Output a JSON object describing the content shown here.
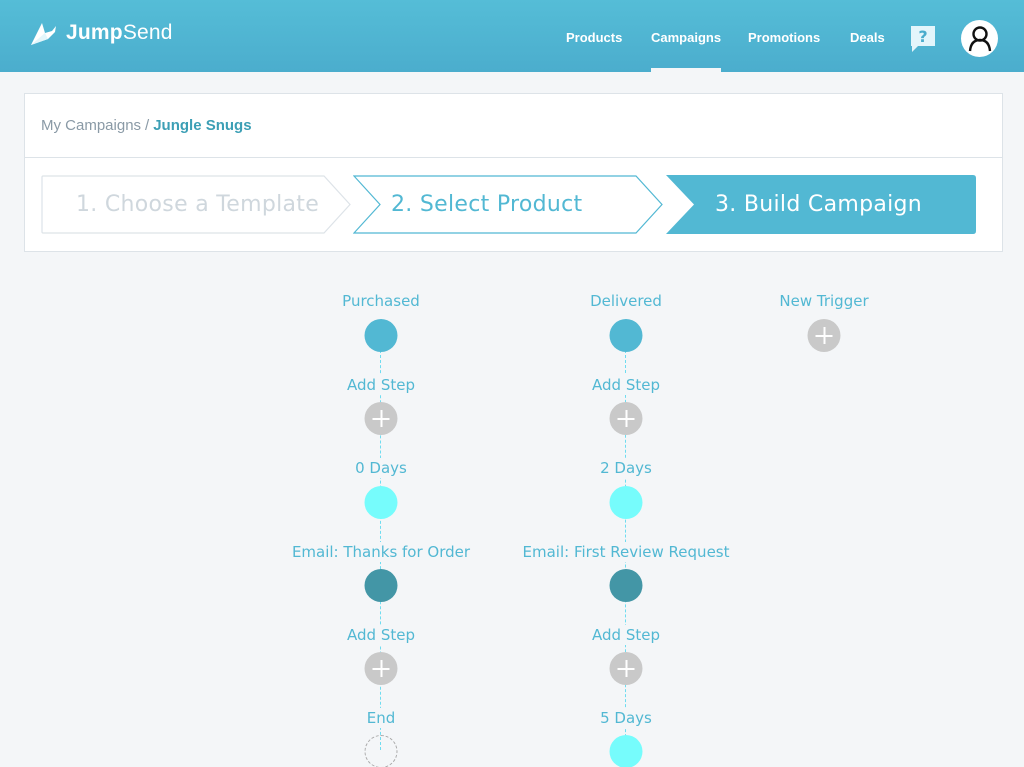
{
  "app": {
    "name_bold": "Jump",
    "name_light": "Send"
  },
  "nav": {
    "items": [
      {
        "label": "Products",
        "active": false
      },
      {
        "label": "Campaigns",
        "active": true
      },
      {
        "label": "Promotions",
        "active": false
      },
      {
        "label": "Deals",
        "active": false
      }
    ],
    "help_icon": "help-question-icon",
    "profile_icon": "user-avatar-icon"
  },
  "breadcrumb": {
    "root": "My Campaigns",
    "separator": "/",
    "current": "Jungle Snugs"
  },
  "steps": [
    {
      "label": "1. Choose a Template",
      "state": "completed"
    },
    {
      "label": "2. Select Product",
      "state": "done-outline"
    },
    {
      "label": "3. Build Campaign",
      "state": "active"
    }
  ],
  "colors": {
    "brand": "#52b8d3",
    "trigger_node": "#52b8d3",
    "delay_node": "#76fcfc",
    "email_node": "#4396a6",
    "add_node": "#c9c9c9",
    "connector": "#6fdcf0"
  },
  "flows": [
    {
      "trigger": "Purchased",
      "steps": [
        {
          "label": "Add Step",
          "type": "add"
        },
        {
          "label": "0 Days",
          "type": "delay"
        },
        {
          "label": "Email: Thanks for Order",
          "type": "email"
        },
        {
          "label": "Add Step",
          "type": "add"
        },
        {
          "label": "End",
          "type": "end"
        }
      ]
    },
    {
      "trigger": "Delivered",
      "steps": [
        {
          "label": "Add Step",
          "type": "add"
        },
        {
          "label": "2 Days",
          "type": "delay"
        },
        {
          "label": "Email: First Review Request",
          "type": "email"
        },
        {
          "label": "Add Step",
          "type": "add"
        },
        {
          "label": "5 Days",
          "type": "delay"
        }
      ]
    }
  ],
  "new_trigger": {
    "label": "New Trigger"
  }
}
